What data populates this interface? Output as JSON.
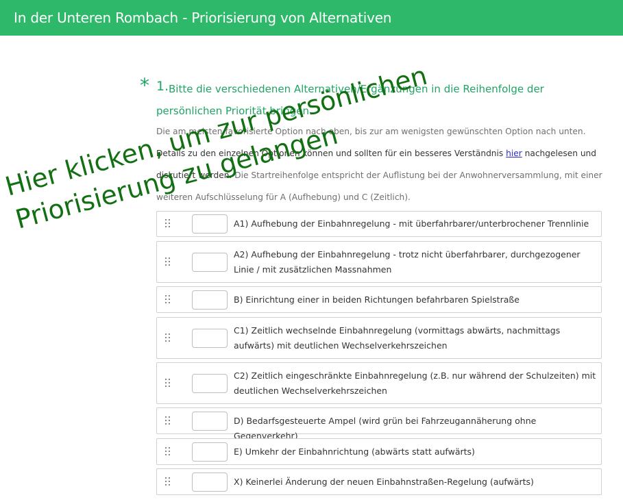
{
  "header": {
    "title": "In der Unteren Rombach - Priorisierung von Alternativen"
  },
  "question": {
    "required_marker": "*",
    "number": "1.",
    "title": "Bitte die verschiedenen Alternativen/Ergänzungen in die Reihenfolge der persönlichen Priorität bringen.",
    "desc_1": "Die am meisten favorisierte Option nach oben, bis zur am wenigsten gewünschten Option nach unten.",
    "desc_2a": "Details zu den einzelnen Optionen können und sollten für ein besseres Verständnis ",
    "desc_2_link": "hier",
    "desc_2b": " nachgelesen und diskutiert werden.",
    "desc_3": "Die Startreihenfolge entspricht der Auflistung bei der Anwohnerversammlung, mit einer weiteren Aufschlüsselung für A (Aufhebung) und C (Zeitlich)."
  },
  "options": [
    {
      "label": "A1) Aufhebung der Einbahnregelung - mit überfahrbarer/unterbrochener Trennlinie",
      "rank": ""
    },
    {
      "label": "A2) Aufhebung der Einbahnregelung - trotz nicht überfahrbarer, durchgezogener Linie / mit zusätzlichen Massnahmen",
      "rank": ""
    },
    {
      "label": "B) Einrichtung einer in beiden Richtungen befahrbaren Spielstraße",
      "rank": ""
    },
    {
      "label": "C1) Zeitlich wechselnde Einbahnregelung (vormittags abwärts, nachmittags aufwärts) mit deutlichen Wechselverkehrszeichen",
      "rank": ""
    },
    {
      "label": "C2) Zeitlich eingeschränkte Einbahnregelung (z.B. nur während der Schulzeiten) mit deutlichen Wechselverkehrszeichen",
      "rank": ""
    },
    {
      "label": "D) Bedarfsgesteuerte Ampel (wird grün bei Fahrzeugannäherung ohne Gegenverkehr)",
      "rank": ""
    },
    {
      "label": "E) Umkehr der Einbahnrichtung (abwärts statt aufwärts)",
      "rank": ""
    },
    {
      "label": "X) Keinerlei Änderung der neuen Einbahnstraßen-Regelung (aufwärts)",
      "rank": ""
    }
  ],
  "overlay": {
    "line_1": "Hier klicken, um zur persönlichen",
    "line_2": "Priorisierung zu gelangen"
  },
  "colors": {
    "brand": "#2eb86a",
    "question": "#1fa463",
    "overlay_text": "#127012",
    "link": "#2b2bd1"
  },
  "icons": {
    "drag_handle": "drag-handle-icon",
    "select_arrows": "select-arrows-icon"
  }
}
